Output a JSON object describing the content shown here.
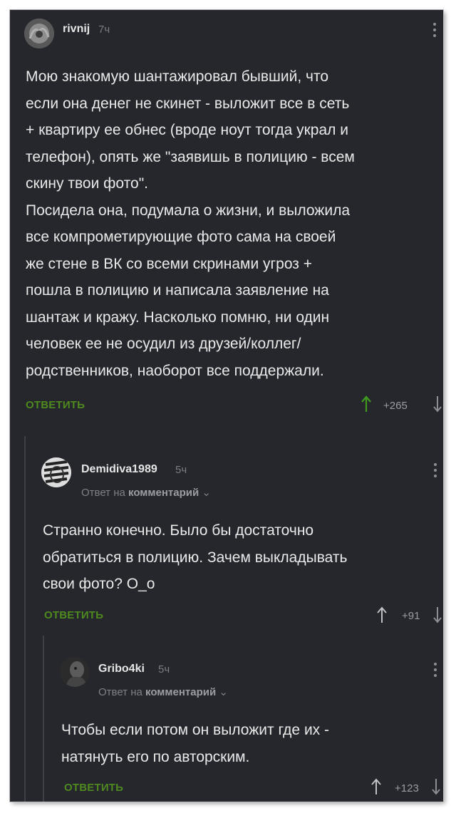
{
  "comments": [
    {
      "username": "rivnij",
      "time": "7ч",
      "reply_to_prefix": "",
      "reply_to_target": "",
      "lines": [
        "Мою знакомую шантажировал бывший, что",
        "если она денег не скинет - выложит все в сеть",
        "+ квартиру ее обнес (вроде ноут тогда украл и",
        "телефон), опять же \"заявишь в полицию - всем",
        "скину твои фото\".",
        "Посидела она, подумала о жизни, и выложила",
        "все компрометирующие фото сама на своей",
        "же стене в ВК со всеми скринами угроз +",
        "пошла в полицию и написала заявление на",
        "шантаж и кражу. Насколько помню, ни один",
        "человек ее не осудил из друзей/коллег/",
        "родственников, наоборот все поддержали."
      ],
      "reply_label": "ОТВЕТИТЬ",
      "score": "+265",
      "avatar_icon": "avatar-photo",
      "menu_icon": "kebab-icon"
    },
    {
      "username": "Demidiva1989",
      "time": "5ч",
      "reply_to_prefix": "Ответ на",
      "reply_to_target": "комментарий",
      "lines": [
        "Странно конечно. Было бы достаточно",
        "обратиться в полицию. Зачем выкладывать",
        "свои фото? О_о"
      ],
      "reply_label": "ОТВЕТИТЬ",
      "score": "+91",
      "avatar_icon": "zebra-avatar",
      "menu_icon": "kebab-icon"
    },
    {
      "username": "Gribo4ki",
      "time": "5ч",
      "reply_to_prefix": "Ответ на",
      "reply_to_target": "комментарий",
      "lines": [
        "Чтобы если потом он выложит где их -",
        "натянуть его по авторским."
      ],
      "reply_label": "ОТВЕТИТЬ",
      "score": "+123",
      "avatar_icon": "dark-avatar",
      "menu_icon": "kebab-icon"
    }
  ],
  "colors": {
    "background": "#25272c",
    "text": "#e9e9e9",
    "reply_green": "#4f8a1f",
    "muted": "#7a7d82"
  }
}
